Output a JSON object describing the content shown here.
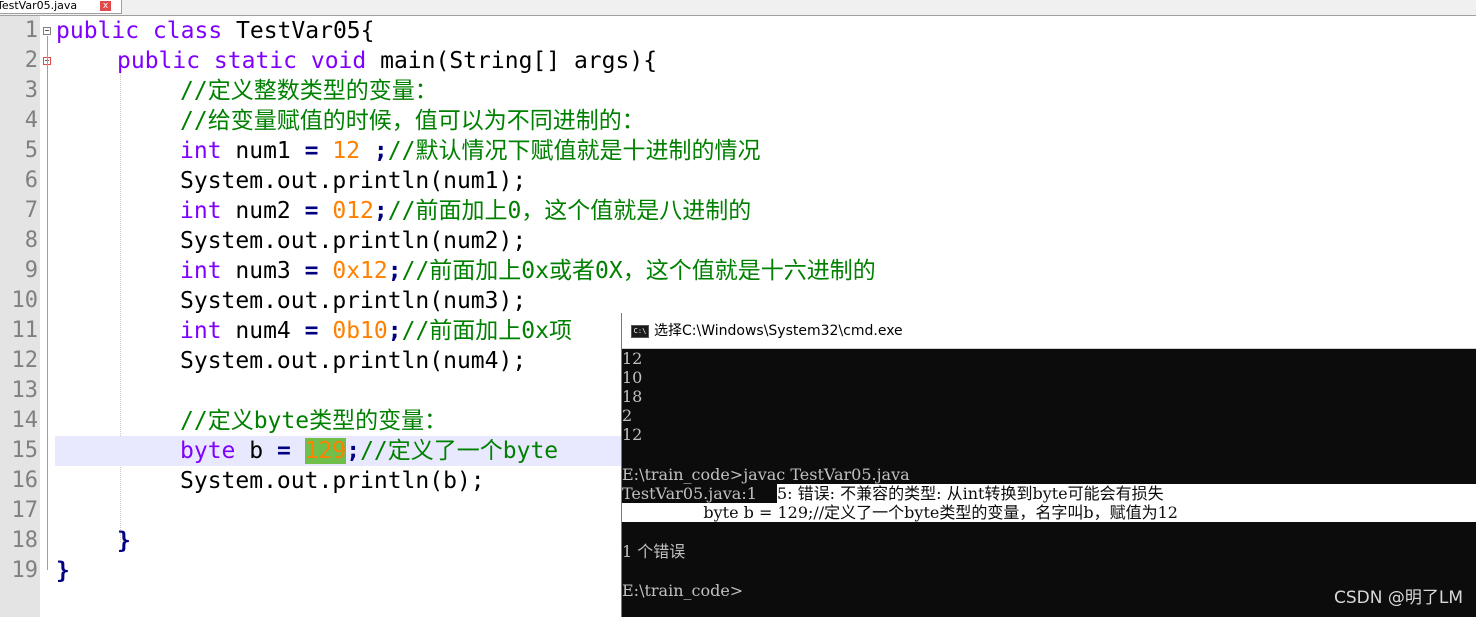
{
  "tab": {
    "label": "TestVar05.java",
    "close_symbol": "x"
  },
  "editor": {
    "line_numbers": [
      "1",
      "2",
      "3",
      "4",
      "5",
      "6",
      "7",
      "8",
      "9",
      "10",
      "11",
      "12",
      "13",
      "14",
      "15",
      "16",
      "17",
      "18",
      "19"
    ]
  },
  "code": {
    "l1_kw": "public class",
    "l1_rest": " TestVar05{",
    "l2_kw": "public static void",
    "l2_rest": " main(String[] args){",
    "l3_cmt": "//定义整数类型的变量：",
    "l4_cmt": "//给变量赋值的时候，值可以为不同进制的：",
    "l5_kw": "int",
    "l5_a": " num1 ",
    "l5_op": "=",
    "l5_num": " 12 ",
    "l5_semi": ";",
    "l5_cmt": "//默认情况下赋值就是十进制的情况",
    "l6": "System.out.println(num1);",
    "l7_kw": "int",
    "l7_a": " num2 ",
    "l7_op": "=",
    "l7_num": " 012",
    "l7_semi": ";",
    "l7_cmt": "//前面加上0，这个值就是八进制的",
    "l8": "System.out.println(num2);",
    "l9_kw": "int",
    "l9_a": " num3 ",
    "l9_op": "=",
    "l9_num": " 0x12",
    "l9_semi": ";",
    "l9_cmt": "//前面加上0x或者0X，这个值就是十六进制的",
    "l10": "System.out.println(num3);",
    "l11_kw": "int",
    "l11_a": " num4 ",
    "l11_op": "=",
    "l11_num": " 0b10",
    "l11_semi": ";",
    "l11_cmt": "//前面加上0x项",
    "l12": "System.out.println(num4);",
    "l14_cmt": "//定义byte类型的变量：",
    "l15_kw": "byte",
    "l15_a": " b ",
    "l15_op": "=",
    "l15_sp": " ",
    "l15_num": "129",
    "l15_semi": ";",
    "l15_cmt": "//定义了一个byte",
    "l16": "System.out.println(b);",
    "l18": "}",
    "l19": "}"
  },
  "cmd": {
    "title": "选择C:\\Windows\\System32\\cmd.exe",
    "icon_text": "C:\\",
    "lines": [
      "12",
      "10",
      "18",
      "2",
      "12",
      "",
      "E:\\train_code>javac TestVar05.java",
      "TestVar05.java:15: 错误: 不兼容的类型: 从int转换到byte可能会有损失",
      "                byte b = 129;//定义了一个byte类型的变量，名字叫b，赋值为12",
      "",
      "1 个错误",
      "",
      "E:\\train_code>"
    ],
    "line7_left": "TestVar05.java:1",
    "line7_right": "5: 错误: 不兼容的类型: 从int转换到byte可能会有损失",
    "line8_text": "                byte b = 129;//定义了一个byte类型的变量，名字叫b，赋值为12"
  },
  "watermark": "CSDN @明了LM"
}
